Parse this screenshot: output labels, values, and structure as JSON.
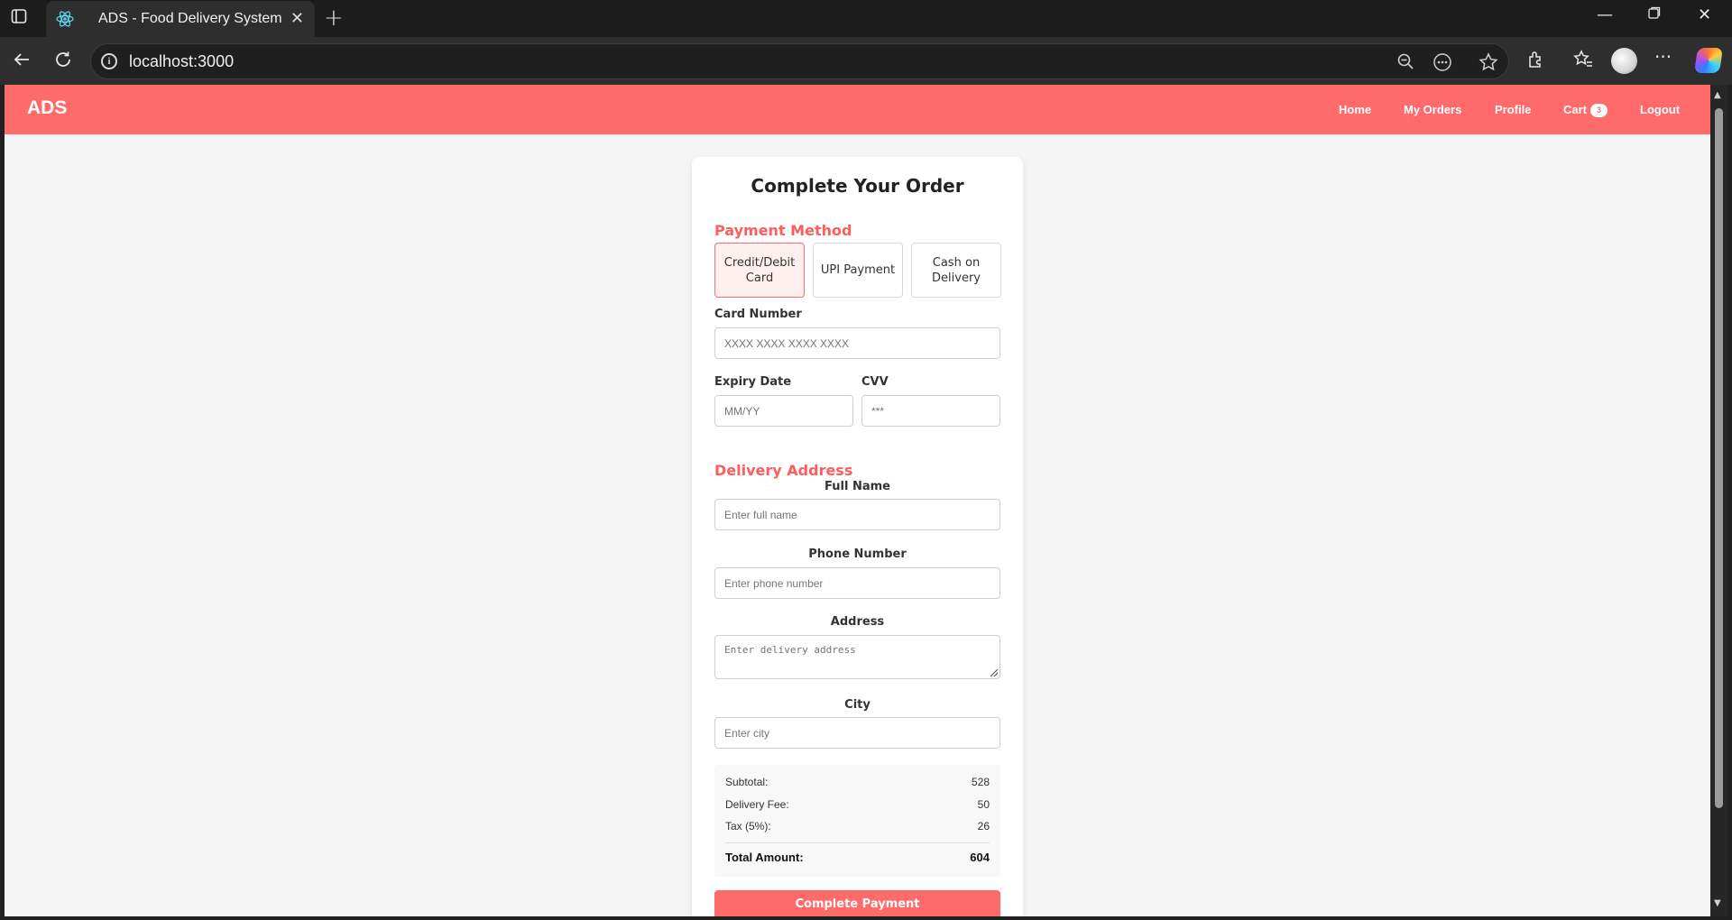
{
  "browser": {
    "tab_title": "ADS - Food Delivery System",
    "url": "localhost:3000"
  },
  "navbar": {
    "logo": "ADS",
    "links": [
      "Home",
      "My Orders",
      "Profile",
      "Cart",
      "Logout"
    ],
    "cart_count": "3",
    "color": "#ff6b6b"
  },
  "checkout": {
    "title": "Complete Your Order",
    "payment": {
      "heading": "Payment Method",
      "methods": [
        "Credit/Debit Card",
        "UPI Payment",
        "Cash on Delivery"
      ],
      "selected": "Credit/Debit Card"
    },
    "card": {
      "number_label": "Card Number",
      "number_placeholder": "XXXX XXXX XXXX XXXX",
      "expiry_label": "Expiry Date",
      "expiry_placeholder": "MM/YY",
      "cvv_label": "CVV",
      "cvv_placeholder": "***"
    },
    "delivery": {
      "heading": "Delivery Address",
      "full_name_label": "Full Name",
      "full_name_placeholder": "Enter full name",
      "phone_label": "Phone Number",
      "phone_placeholder": "Enter phone number",
      "address_label": "Address",
      "address_placeholder": "Enter delivery address",
      "city_label": "City",
      "city_placeholder": "Enter city"
    },
    "summary": {
      "subtotal_label": "Subtotal:",
      "subtotal": "528",
      "delivery_fee_label": "Delivery Fee:",
      "delivery_fee": "50",
      "tax_label": "Tax (5%):",
      "tax": "26",
      "total_label": "Total Amount:",
      "total": "604"
    },
    "submit_label": "Complete Payment"
  }
}
